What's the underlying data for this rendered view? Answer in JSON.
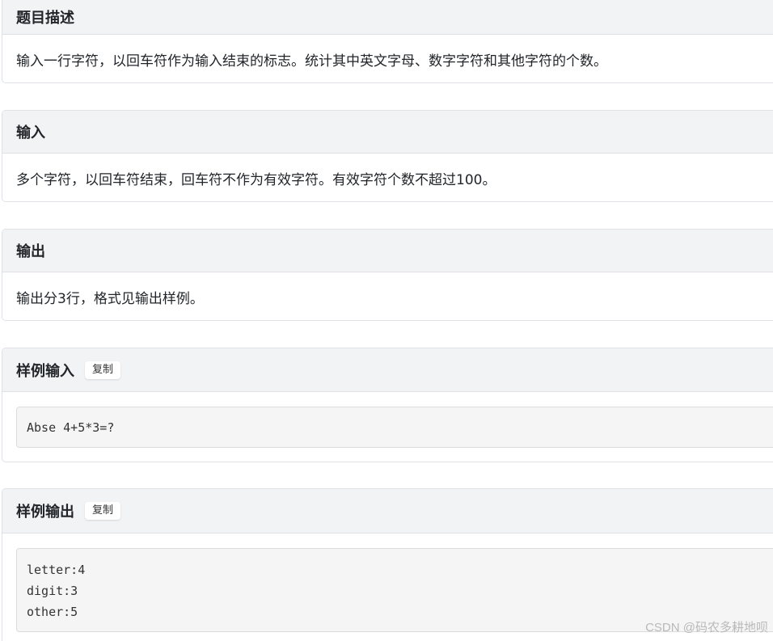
{
  "sections": {
    "description": {
      "title": "题目描述",
      "content": "输入一行字符，以回车符作为输入结束的标志。统计其中英文字母、数字字符和其他字符的个数。"
    },
    "input": {
      "title": "输入",
      "content": "多个字符，以回车符结束，回车符不作为有效字符。有效字符个数不超过100。"
    },
    "output": {
      "title": "输出",
      "content": "输出分3行，格式见输出样例。"
    },
    "sample_input": {
      "title": "样例输入",
      "copy_label": "复制",
      "lines": [
        "Abse 4+5*3=?"
      ]
    },
    "sample_output": {
      "title": "样例输出",
      "copy_label": "复制",
      "lines": [
        "letter:4",
        "digit:3",
        "other:5"
      ]
    }
  },
  "watermark": "CSDN @码农多耕地呗"
}
